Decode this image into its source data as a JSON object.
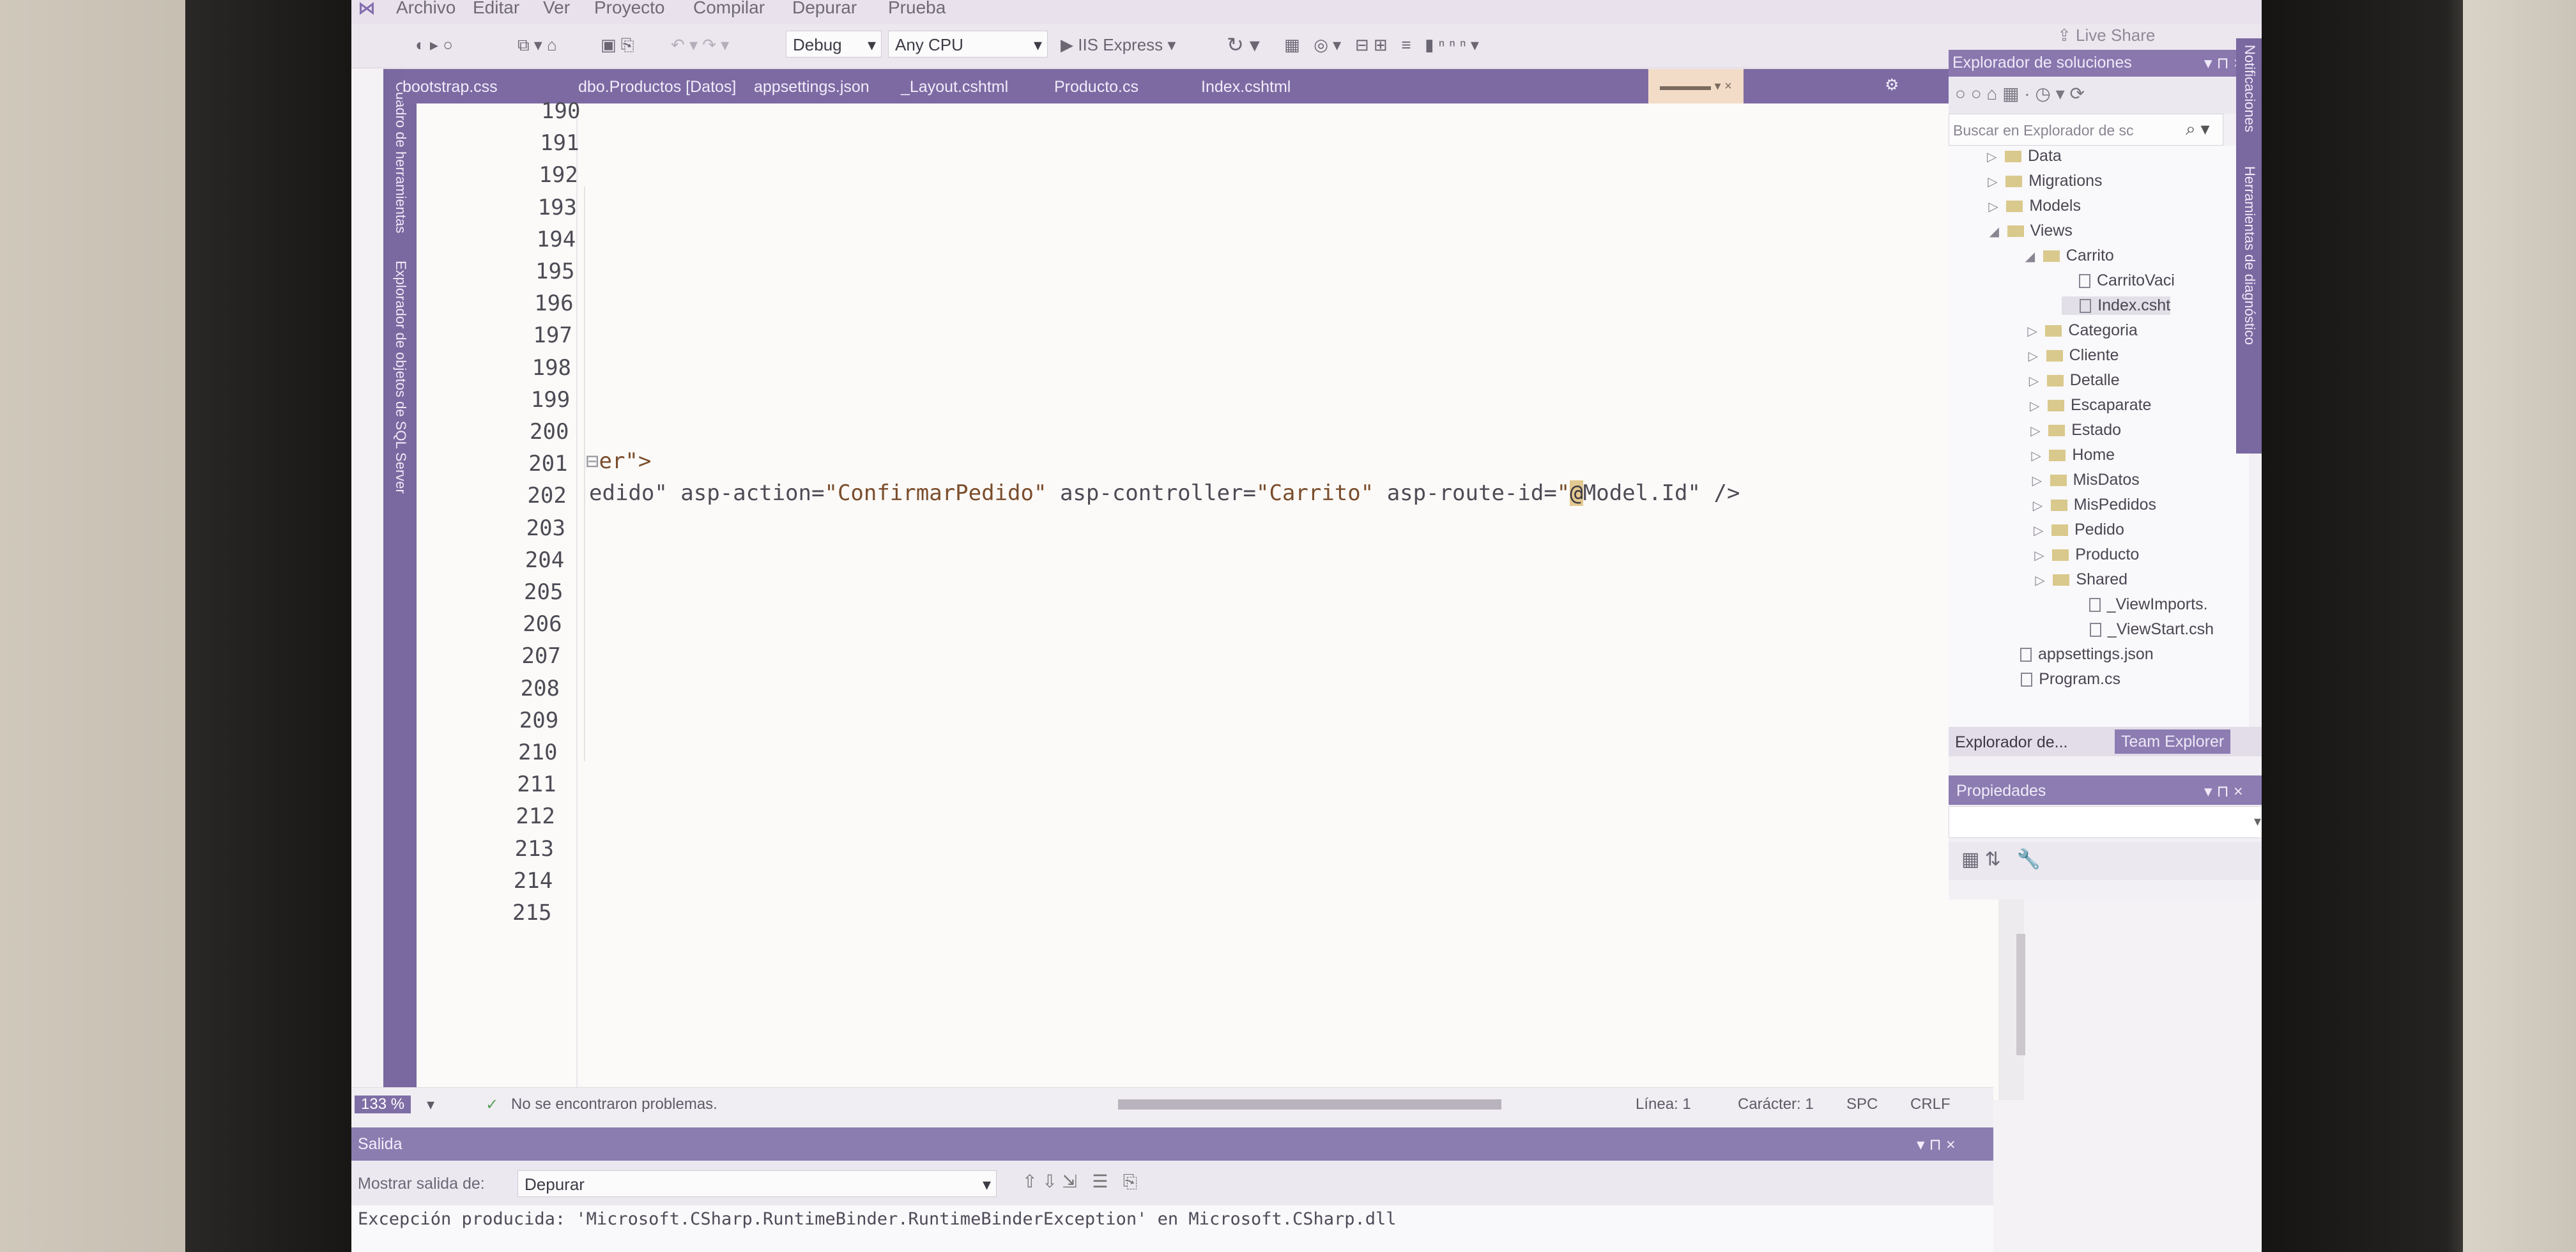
{
  "menu": [
    "Archivo",
    "Editar",
    "Ver",
    "Proyecto",
    "Compilar",
    "Depurar",
    "Prueba"
  ],
  "toolbar": {
    "config": "Debug",
    "platform": "Any CPU",
    "run_target": "IIS Express",
    "live_share": "Live Share"
  },
  "tabs": [
    "bootstrap.css",
    "dbo.Productos [Datos]",
    "appsettings.json",
    "_Layout.cshtml",
    "Producto.cs",
    "Index.cshtml"
  ],
  "left_strip": [
    "Cuadro de herramientas",
    "Explorador de objetos de SQL Server"
  ],
  "right_strip": [
    "Notificaciones",
    "Herramientas de diagnóstico"
  ],
  "editor": {
    "line_numbers": [
      "190",
      "191",
      "192",
      "193",
      "194",
      "195",
      "196",
      "197",
      "198",
      "199",
      "200",
      "201",
      "202",
      "203",
      "204",
      "205",
      "206",
      "207",
      "208",
      "209",
      "210",
      "211",
      "212",
      "213",
      "214",
      "215"
    ],
    "line201": "er\">",
    "line202_start": "edido\" asp-action=",
    "line202_action": "\"ConfirmarPedido\"",
    "line202_ctrl_attr": " asp-controller=",
    "line202_ctrl": "\"Carrito\"",
    "line202_route_attr": " asp-route-id=",
    "line202_quote": "\"",
    "line202_at": "@",
    "line202_model": "Model.Id\"",
    "line202_end": " />"
  },
  "status": {
    "zoom": "133 %",
    "issues": "No se encontraron problemas.",
    "line": "Línea: 1",
    "char": "Carácter: 1",
    "spc": "SPC",
    "crlf": "CRLF"
  },
  "output": {
    "title": "Salida",
    "show_label": "Mostrar salida de:",
    "source": "Depurar",
    "text": "Excepción producida: 'Microsoft.CSharp.RuntimeBinder.RuntimeBinderException' en Microsoft.CSharp.dll"
  },
  "solution_explorer": {
    "title": "Explorador de soluciones",
    "search_placeholder": "Buscar en Explorador de sc",
    "items": [
      {
        "label": "Data",
        "type": "folder",
        "depth": 0
      },
      {
        "label": "Migrations",
        "type": "folder",
        "depth": 0
      },
      {
        "label": "Models",
        "type": "folder",
        "depth": 0
      },
      {
        "label": "Views",
        "type": "folder-open",
        "depth": 0
      },
      {
        "label": "Carrito",
        "type": "folder-open",
        "depth": 1
      },
      {
        "label": "CarritoVaci",
        "type": "file",
        "depth": 2
      },
      {
        "label": "Index.csht",
        "type": "file",
        "depth": 2
      },
      {
        "label": "Categoria",
        "type": "folder",
        "depth": 1
      },
      {
        "label": "Cliente",
        "type": "folder",
        "depth": 1
      },
      {
        "label": "Detalle",
        "type": "folder",
        "depth": 1
      },
      {
        "label": "Escaparate",
        "type": "folder",
        "depth": 1
      },
      {
        "label": "Estado",
        "type": "folder",
        "depth": 1
      },
      {
        "label": "Home",
        "type": "folder",
        "depth": 1
      },
      {
        "label": "MisDatos",
        "type": "folder",
        "depth": 1
      },
      {
        "label": "MisPedidos",
        "type": "folder",
        "depth": 1
      },
      {
        "label": "Pedido",
        "type": "folder",
        "depth": 1
      },
      {
        "label": "Producto",
        "type": "folder",
        "depth": 1
      },
      {
        "label": "Shared",
        "type": "folder",
        "depth": 1
      },
      {
        "label": "_ViewImports.",
        "type": "file",
        "depth": 2
      },
      {
        "label": "_ViewStart.csh",
        "type": "file",
        "depth": 2
      },
      {
        "label": "appsettings.json",
        "type": "file",
        "depth": 0
      },
      {
        "label": "Program.cs",
        "type": "file",
        "depth": 0
      }
    ],
    "tab_active": "Explorador de...",
    "tab_other": "Team Explorer"
  },
  "properties": {
    "title": "Propiedades"
  }
}
